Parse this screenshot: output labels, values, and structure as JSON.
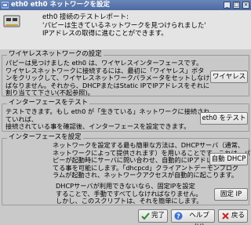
{
  "window": {
    "title": "eth0 eth0 ネットワークを設定",
    "minimize_glyph": "_",
    "maximize_glyph": "□",
    "close_glyph": "×"
  },
  "header": {
    "report_title": "eth0 接続のテストレポート:",
    "report_line1": "'パピーは生きているネットワークを見つけられました'",
    "report_line2": "IPアドレスの取得に進むことができます。"
  },
  "wireless": {
    "legend": "ワイヤレスネットワークの設定",
    "text": "パピーは見つけました eth0 は、ワイヤレスインターフェースです。\nワイヤレスネットワークに接続するには、最初に「ワイヤレス」ボタ\nンをクリックして、ワイヤレスネットワークパラメータをセットしなけれ\nばなりません。それから、DHCPまたはStatic IPでIPアドレスをそれに\n割り当てて下さい(不起参照)。",
    "button": "ワイヤレス"
  },
  "test": {
    "legend": "インターフェースをテスト",
    "text": "テストできます。もし eth0 が「生きている」ネットワークに接続され\nていれば、\n接続されている事を確認後、インターフェースを設定できます。",
    "button": "eth0 をテスト"
  },
  "configure": {
    "legend": "インターフェースを設定",
    "text1": "ネットワークを設定する最も簡単な方法は、DHCPサーバ（通常、\nネットワークによって提供されます）を用いることです。これは、パ\nピーが起動時にサーバに問い合わせ、自動的にIPアドレスを割り当\nてる事を可能にします。「dhcpcd」クライアントデーモンプログ\nラムが起動され、ネットワークアクセスが自動的に起こります。",
    "dhcp_button": "自動 DHCP",
    "text2": "DHCPサーバが利用できないなら、固定IPを設定\nすることで、手動ですべてしなければなりません。\nしかし、このスクリプトは、それを簡単にします。",
    "static_button": "固定 IP"
  },
  "buttons": {
    "done": "完了",
    "help": "ヘルプ(H)",
    "back": "戻る"
  }
}
